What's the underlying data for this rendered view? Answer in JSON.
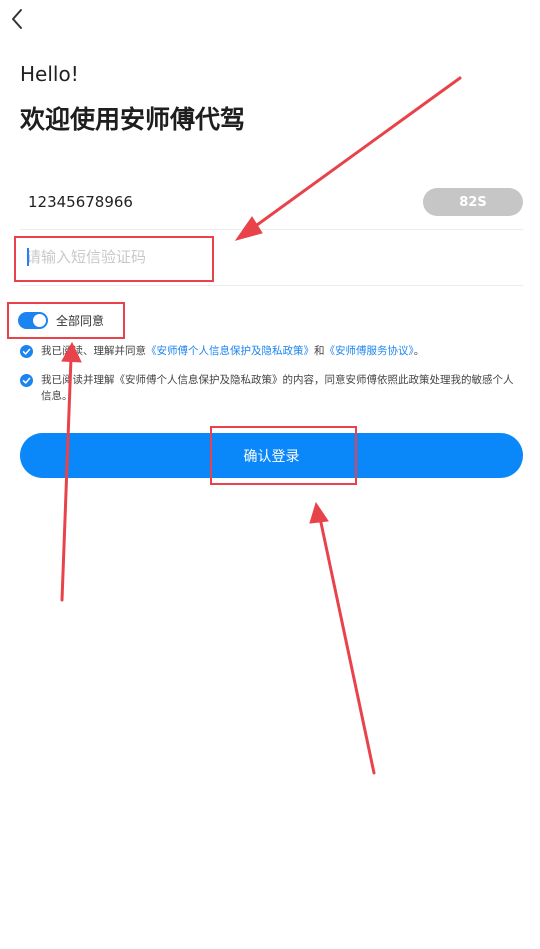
{
  "header": {
    "back_icon": "chevron-left-icon",
    "greeting": "Hello!",
    "welcome": "欢迎使用安师傅代驾"
  },
  "login_form": {
    "phone_number": "12345678966",
    "countdown_label": "82S",
    "code_placeholder": "请输入短信验证码",
    "code_value": ""
  },
  "agreements": {
    "agree_all_label": "全部同意",
    "agree_all_on": true,
    "item1": {
      "prefix": "我已阅读、理解并同意",
      "link1": "《安师傅个人信息保护及隐私政策》",
      "middle": "和",
      "link2": "《安师傅服务协议》",
      "suffix": "。",
      "checked": true
    },
    "item2": {
      "text": "我已阅读并理解《安师傅个人信息保护及隐私政策》的内容，同意安师傅依照此政策处理我的敏感个人信息。",
      "checked": true
    }
  },
  "actions": {
    "confirm_label": "确认登录"
  },
  "colors": {
    "accent": "#0a87f8",
    "toggle": "#1b84f0",
    "countdown_bg": "#c6c6c6",
    "annotation": "#e8424a"
  }
}
